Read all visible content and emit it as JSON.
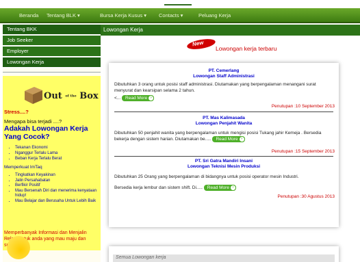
{
  "nav": {
    "items": [
      "Beranda",
      "Tentang BLK ▾",
      "Bursa Kerja Kusus ▾",
      "Contacts ▾",
      "Peluang Kerja"
    ]
  },
  "sidebar": {
    "menu": [
      "Tentang BKK",
      "Job Seeker",
      "Employer",
      "Lowongan Kerja"
    ],
    "logo": {
      "main": "Out",
      "small": "of the",
      "end": "Box"
    },
    "stress": "Stress....?",
    "ask": "Mengapa bisa terjadi ....?",
    "big_question": "Adakah Lowongan Kerja Yang Cocok?",
    "reasons": [
      "Tekanan Ekonomi",
      "Nganggur Terlalu Lama",
      "Beban Kerja Terlalu Berat"
    ],
    "imtaq_title": "Memperkuat ImTaq",
    "imtaq_items": [
      "Tingkatkan Keyakinan",
      "Jalin Persahabatan",
      "Berfikir Positif",
      "Mau Bersenah Diri dan menerima kenyataan hidup!",
      "Mau Belajar dan Berusaha Untuk Lebih Baik"
    ],
    "closing": "Memperbanyak Informasi dan Menjalin Relasi untuk anda yang mau maju dan sukses....?"
  },
  "main": {
    "header": "Lowongan Kerja",
    "badge": "New",
    "newest_label": "Lowongan kerja terbaru",
    "read_more": "Read More",
    "jobs": [
      {
        "company": "PT. Cemerlang",
        "position": "Lowongan Staff Administrasi",
        "desc": "Dibutuhkan 3 orang untuk posisi staff administrasi. Diutamakan yang berpengalaman menangani surat menyurat dan kearsipan selama 2 tahun.",
        "prefix": "<...",
        "deadline": "Penutupan :10 September 2013"
      },
      {
        "company": "PT. Mas Kalimasada",
        "position": "Lowongan Penjahit Wanita",
        "desc": "Dibutuhkan 50 penjahit wanita yang berpengalaman untuk mengisi posisi Tukang jahir Kemeja . Bersedia bekerja dengan sistem harian. Diutamakan be.....",
        "prefix": "",
        "deadline": "Penutupan :15 September 2013"
      },
      {
        "company": "PT. Sri Gatra Mandiri Insani",
        "position": "Lowongan Teknisi Mesin Produksi",
        "desc": "Dibutuhkan 25 Orang yang berpengalaman di bidangnya untuk posisi operator mesin Industri.",
        "desc2": "Bersedia kerja lembur dan sistem shift. Di.....",
        "prefix": "",
        "deadline": "Penutupan :30 Agustus 2013"
      }
    ],
    "all_jobs": "Semua Lowongan kerja"
  }
}
